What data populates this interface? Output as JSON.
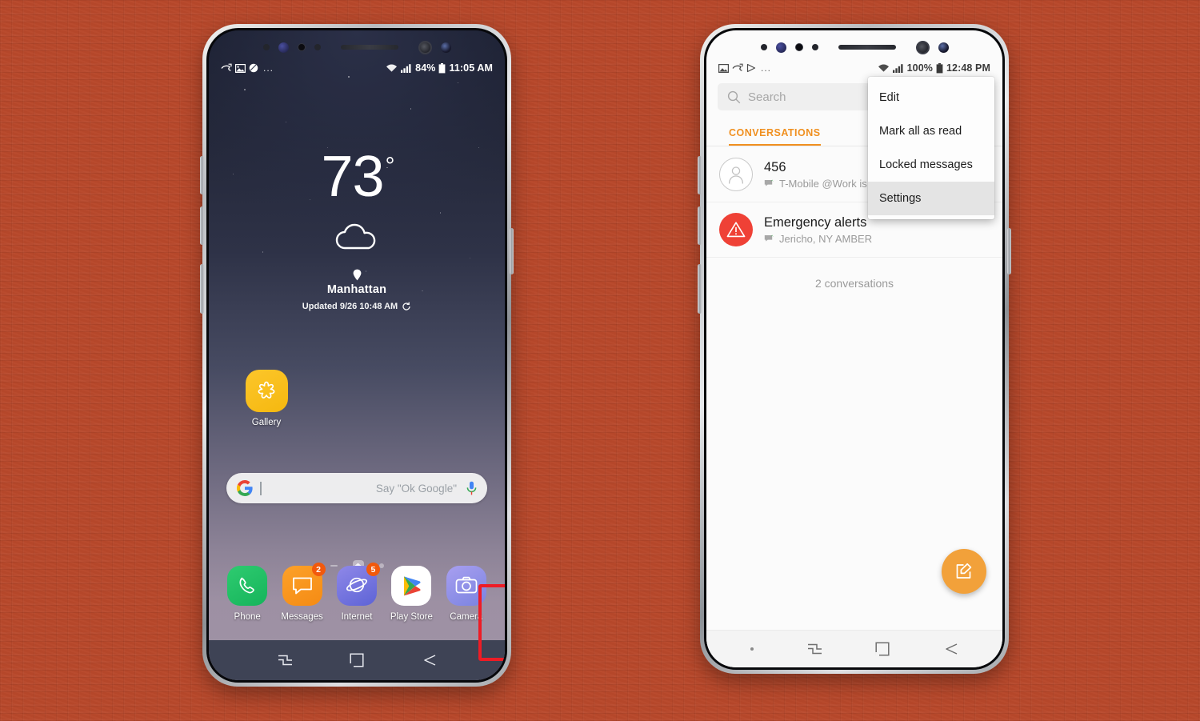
{
  "background": {
    "color": "#b8482b",
    "texture": "woven-fabric"
  },
  "left_phone": {
    "device": "Samsung Galaxy S8",
    "status_bar": {
      "icons": [
        "missed-call-icon",
        "image-icon",
        "circle-icon",
        "more-dots"
      ],
      "dots": "...",
      "wifi": "wifi-icon",
      "signal": "signal-bars-icon",
      "battery_percent": "84%",
      "battery": "battery-icon",
      "time": "11:05 AM"
    },
    "weather": {
      "temperature": "73",
      "degree": "°",
      "condition_icon": "cloud-icon",
      "location_icon": "location-pin-icon",
      "city": "Manhattan",
      "updated": "Updated 9/26 10:48 AM",
      "refresh_icon": "refresh-icon"
    },
    "apps": [
      {
        "name": "Gallery",
        "icon": "gallery-icon"
      }
    ],
    "search_widget": {
      "logo": "google-g-icon",
      "placeholder": "Say \"Ok Google\"",
      "mic_icon": "microphone-icon"
    },
    "page_indicator": {
      "items": [
        "page-line",
        "home-page-active",
        "page-dot"
      ]
    },
    "dock": [
      {
        "name": "Phone",
        "icon": "phone-icon",
        "badge": "",
        "highlighted": false
      },
      {
        "name": "Messages",
        "icon": "messages-icon",
        "badge": "2",
        "highlighted": true
      },
      {
        "name": "Internet",
        "icon": "internet-icon",
        "badge": "5",
        "highlighted": false
      },
      {
        "name": "Play Store",
        "icon": "play-store-icon",
        "badge": "",
        "highlighted": false
      },
      {
        "name": "Camera",
        "icon": "camera-icon",
        "badge": "",
        "highlighted": false
      }
    ],
    "highlight_color": "#ee1c25",
    "nav_bar": [
      "recents-icon",
      "home-icon",
      "back-icon"
    ]
  },
  "right_phone": {
    "device": "Samsung Galaxy S8",
    "status_bar": {
      "icons": [
        "image-icon",
        "missed-call-icon",
        "play-icon",
        "more-dots"
      ],
      "dots": "...",
      "wifi": "wifi-icon",
      "signal": "signal-bars-icon",
      "battery_percent": "100%",
      "battery": "battery-icon",
      "time": "12:48 PM"
    },
    "search": {
      "placeholder": "Search",
      "icon": "search-icon"
    },
    "tabs": [
      {
        "label": "CONVERSATIONS",
        "active": true,
        "color": "#f09020"
      }
    ],
    "conversations": [
      {
        "name": "456",
        "preview": "T-Mobile @Work is",
        "status_icon": "delivered-icon",
        "avatar": "contact-avatar-icon"
      },
      {
        "name": "Emergency alerts",
        "preview": "Jericho, NY AMBER",
        "status_icon": "delivered-icon",
        "avatar": "alert-triangle-icon"
      }
    ],
    "conversation_count": "2 conversations",
    "overflow_menu": [
      {
        "label": "Edit",
        "pressed": false
      },
      {
        "label": "Mark all as read",
        "pressed": false
      },
      {
        "label": "Locked messages",
        "pressed": false
      },
      {
        "label": "Settings",
        "pressed": true
      }
    ],
    "fab": {
      "icon": "compose-icon",
      "color": "#f2a13a"
    },
    "nav_bar": [
      "status-dot",
      "recents-icon",
      "home-icon",
      "back-icon"
    ]
  }
}
